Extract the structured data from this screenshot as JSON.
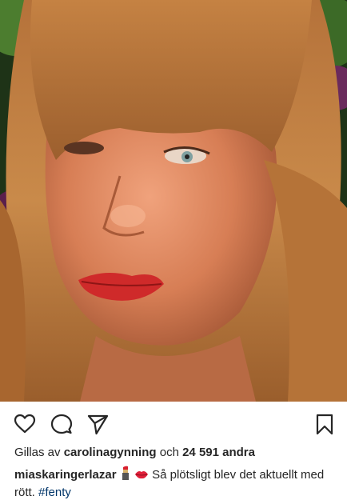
{
  "post": {
    "photo_alt": "",
    "likes": {
      "prefix": "Gillas av",
      "liker": "carolinagynning",
      "conjunction": "och",
      "count": "24 591 andra"
    },
    "caption": {
      "username": "miaskaringerlazar",
      "emojis": [
        "lipstick-icon",
        "kiss-lips-icon"
      ],
      "text": "Så plötsligt blev det aktuellt med rött.",
      "hashtag": "#fenty"
    }
  },
  "colors": {
    "text": "#262626",
    "hashtag": "#003569",
    "background": "#ffffff"
  }
}
